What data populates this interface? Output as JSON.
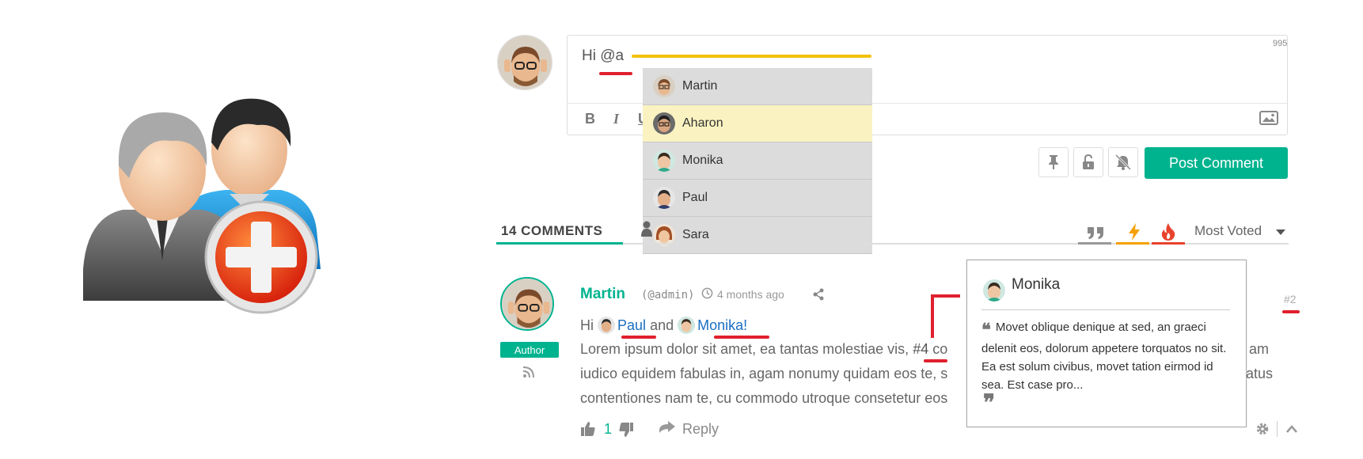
{
  "editor": {
    "text": "Hi @a",
    "char_count": "995",
    "toolbar": {
      "bold": "B",
      "italic": "I",
      "underline": "U"
    }
  },
  "mention_dropdown": {
    "items": [
      {
        "name": "Martin"
      },
      {
        "name": "Aharon",
        "highlighted": true
      },
      {
        "name": "Monika"
      },
      {
        "name": "Paul"
      },
      {
        "name": "Sara"
      }
    ]
  },
  "actions": {
    "post_label": "Post Comment",
    "icons": [
      "pin-icon",
      "unlock-icon",
      "bell-off-icon"
    ]
  },
  "tabs": {
    "comments_count": "14 COMMENTS",
    "sort_label": "Most Voted",
    "sort_icons": [
      "quote-icon",
      "bolt-icon",
      "fire-icon"
    ]
  },
  "comment": {
    "author": "Martin",
    "handle": "(@admin)",
    "time": "4 months ago",
    "badge": "Author",
    "number": "#2",
    "line1": {
      "greeting": "Hi",
      "mention1": "Paul",
      "and": "and",
      "mention2": "Monika",
      "end": "!"
    },
    "body": {
      "p1_before": "Lorem ipsum dolor sit amet, ea tantas molestiae vis,",
      "ref": "#4",
      "p1_after": "co",
      "p1_tail": "am",
      "p2": "iudico equidem fabulas in, agam nonumy quidam eos te, s",
      "p2_tail": "atus",
      "p3": "contentiones nam te, cu commodo utroque consetetur eos"
    },
    "votes": "1",
    "reply_label": "Reply"
  },
  "popup": {
    "name": "Monika",
    "text": "Movet oblique denique at sed, an graeci delenit eos, dolorum appetere torquatos no sit. Ea est solum civibus, movet tation eirmod id sea. Est case pro..."
  },
  "colors": {
    "accent": "#00b38f",
    "highlight": "#f4c20d",
    "mark_red": "#e0202e",
    "link": "#1a6fc3"
  }
}
